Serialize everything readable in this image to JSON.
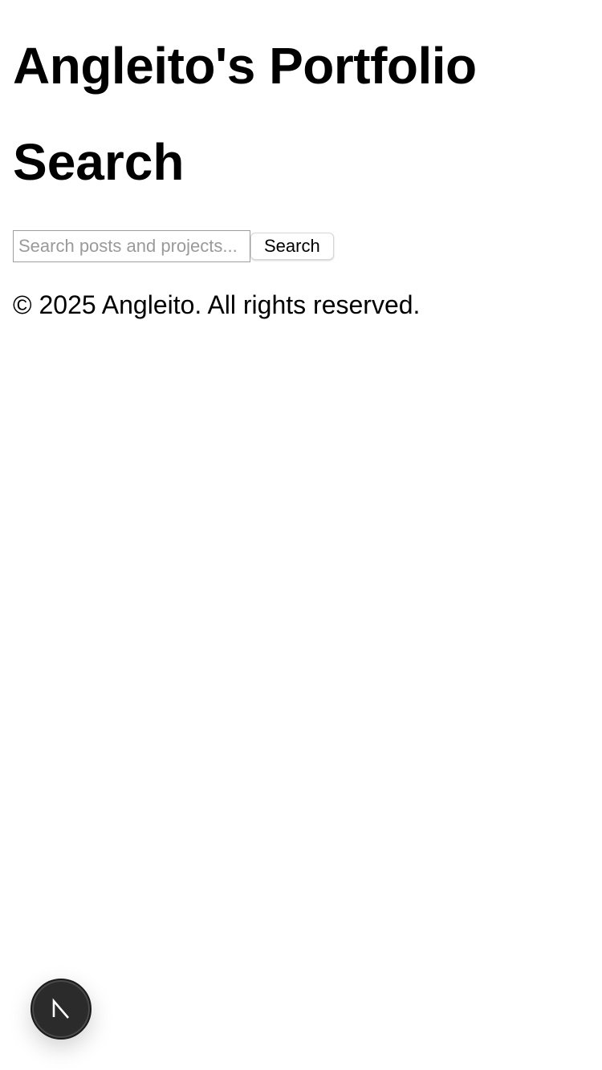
{
  "header": {
    "site_title": "Angleito's Portfolio"
  },
  "main": {
    "page_title": "Search",
    "search": {
      "placeholder": "Search posts and projects...",
      "value": "",
      "button_label": "Search"
    }
  },
  "footer": {
    "copyright": "© 2025 Angleito. All rights reserved."
  },
  "dev_indicator": {
    "icon": "nextjs-logo-icon",
    "letter": "N"
  }
}
